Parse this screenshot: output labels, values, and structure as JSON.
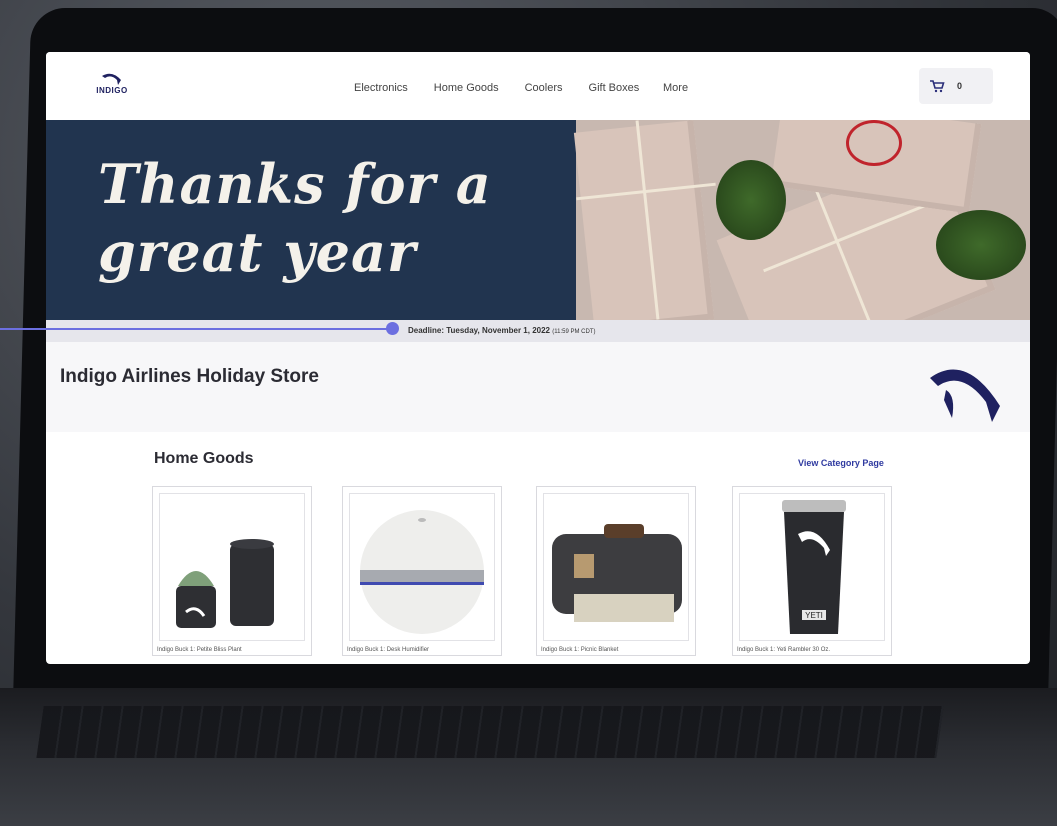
{
  "brand": {
    "logo_word": "INDIGO",
    "accent": "#1f2160",
    "link": "#2f3aa0",
    "hero_bg": "#21344f"
  },
  "nav": {
    "links": [
      "Electronics",
      "Home Goods",
      "Coolers",
      "Gift Boxes"
    ],
    "more": "More",
    "cart_count": "0",
    "cart_icon": "cart-icon"
  },
  "hero": {
    "title_line1": "Thanks for a",
    "title_line2": "great year"
  },
  "deadline": {
    "label": "Deadline: Tuesday, November 1, 2022",
    "time": "(11:59 PM CDT)"
  },
  "store": {
    "title": "Indigo Airlines Holiday Store"
  },
  "category": {
    "title": "Home Goods",
    "link": "View Category Page",
    "products": [
      {
        "name": "Indigo Buck 1: Petite Bliss Plant"
      },
      {
        "name": "Indigo Buck 1: Desk Humidifier"
      },
      {
        "name": "Indigo Buck 1: Picnic Blanket"
      },
      {
        "name": "Indigo Buck 1: Yeti Rambler 30 Oz."
      }
    ]
  },
  "tumbler_brand": "YETI"
}
